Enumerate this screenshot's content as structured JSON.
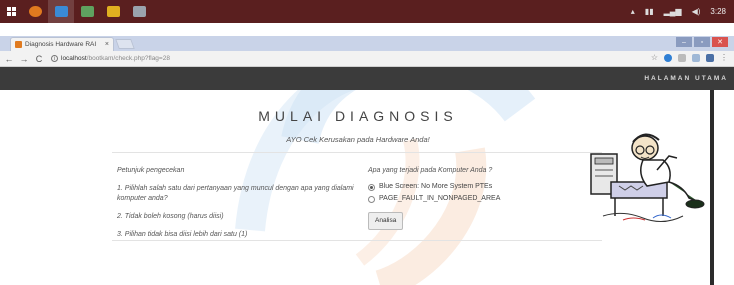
{
  "taskbar": {
    "apps": [
      {
        "name": "start",
        "color": "#ffffff"
      },
      {
        "name": "app-1",
        "color": "#e07a1f"
      },
      {
        "name": "app-2",
        "color": "#3a8bd6"
      },
      {
        "name": "app-3",
        "color": "#5fa25f"
      },
      {
        "name": "app-4",
        "color": "#e0b020"
      },
      {
        "name": "app-5",
        "color": "#9aa3ad"
      }
    ],
    "clock": "3:28"
  },
  "browser": {
    "tab_title": "Diagnosis Hardware RAI",
    "tab_close": "×",
    "url_host": "localhost",
    "url_path": "/bootkam/check.php?flag=28",
    "back": "←",
    "forward": "→",
    "reload": "C",
    "star": "☆",
    "menu": "⋮"
  },
  "site_nav": {
    "home_link": "HALAMAN UTAMA"
  },
  "page": {
    "title": "MULAI DIAGNOSIS",
    "subtitle": "AYO Cek Kerusakan pada Hardware Anda!",
    "instructions": {
      "label": "Petunjuk pengecekan",
      "rules": [
        "1. Pilihlah salah satu dari pertanyaan yang muncul dengan apa yang dialami komputer anda?",
        "2. Tidak boleh kosong (harus diisi)",
        "3. Pilihan tidak bisa diisi lebih dari satu (1)"
      ]
    },
    "question": {
      "label": "Apa yang terjadi pada Komputer Anda ?",
      "options": [
        {
          "label": "Blue Screen: No More System PTEs",
          "checked": true
        },
        {
          "label": "PAGE_FAULT_IN_NONPAGED_AREA",
          "checked": false
        }
      ],
      "submit_label": "Analisa"
    }
  },
  "colors": {
    "taskbar": "#5a1f1f",
    "navbar": "#3b3b3b",
    "watermark_blue": "#cfe3f5",
    "watermark_orange": "#f8dcc8"
  }
}
